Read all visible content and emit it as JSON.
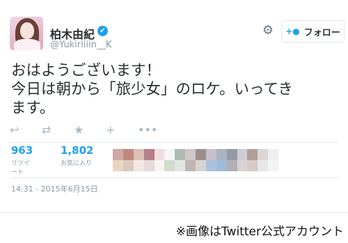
{
  "user": {
    "display_name": "柏木由紀",
    "handle": "@Yukiriiiin__K",
    "verified_icon": "✔"
  },
  "header": {
    "settings_icon": "⚙",
    "follow_label": "フォロー",
    "follow_icon": "+👤"
  },
  "tweet": {
    "lines": [
      "おはようございます！",
      "今日は朝から「旅少女」のロケ。いってき",
      "ます。"
    ]
  },
  "actions": {
    "reply_icon": "↩",
    "retweet_icon": "⇄",
    "favorite_icon": "★",
    "follow_icon": "+",
    "more_icon": "•••"
  },
  "stats": {
    "retweets_count": "963",
    "retweets_label": "リツイート",
    "favorites_count": "1,802",
    "favorites_label": "お気に入り"
  },
  "timestamp": "14:31 - 2015年6月15日",
  "caption": "※画像はTwitter公式アカウント",
  "colors": {
    "accent": "#1da1f2",
    "muted": "#8899a6",
    "text": "#292f33"
  }
}
